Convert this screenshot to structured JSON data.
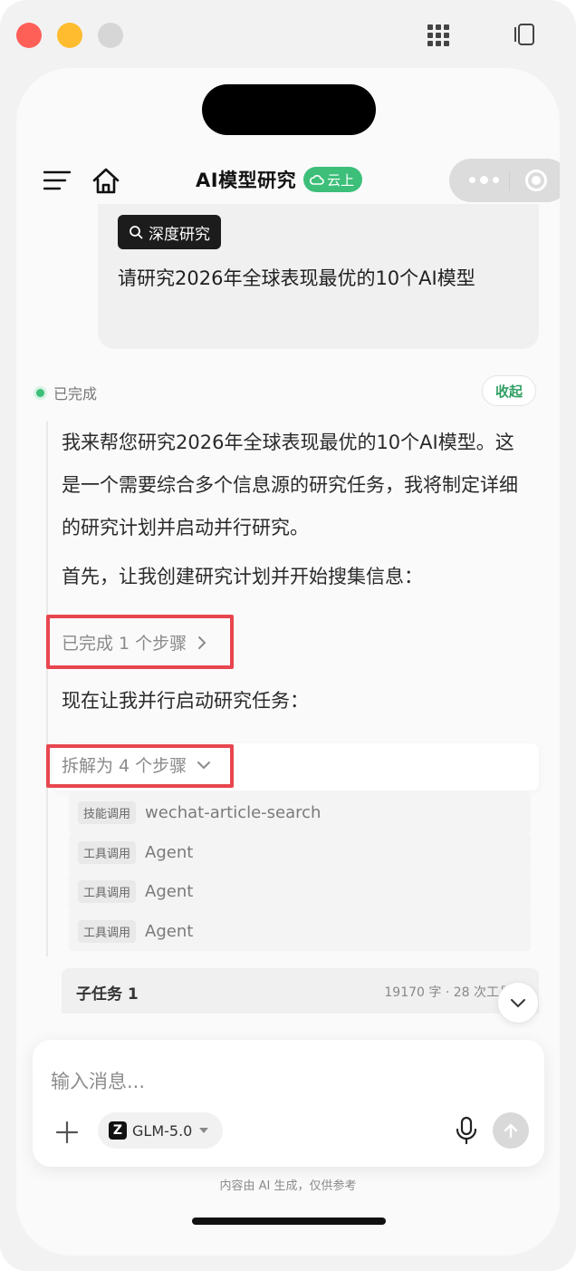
{
  "window": {
    "controls": [
      "close",
      "minimize",
      "zoom"
    ],
    "right_icons": [
      "grid-icon",
      "sidebar-toggle-icon"
    ]
  },
  "header": {
    "title": "AI模型研究",
    "badge": "云上",
    "badge_color": "#3dbf7a"
  },
  "user_message": {
    "tag": "深度研究",
    "text": "请研究2026年全球表现最优的10个AI模型"
  },
  "status": {
    "label": "已完成",
    "collapse_label": "收起"
  },
  "assistant": {
    "paragraph1": "我来帮您研究2026年全球表现最优的10个AI模型。这是一个需要综合多个信息源的研究任务，我将制定详细的研究计划并启动并行研究。",
    "paragraph2": "首先，让我创建研究计划并开始搜集信息：",
    "step1": "已完成 1 个步骤",
    "paragraph3": "现在让我并行启动研究任务：",
    "step2": "拆解为 4 个步骤",
    "tools": [
      {
        "tag": "技能调用",
        "name": "wechat-article-search"
      },
      {
        "tag": "工具调用",
        "name": "Agent"
      },
      {
        "tag": "工具调用",
        "name": "Agent"
      },
      {
        "tag": "工具调用",
        "name": "Agent"
      }
    ],
    "subtask": {
      "title": "子任务 1",
      "meta": "19170 字 · 28 次工具"
    }
  },
  "composer": {
    "placeholder": "输入消息...",
    "model": "GLM-5.0",
    "model_logo": "Z"
  },
  "footer": {
    "disclaimer": "内容由 AI 生成，仅供参考"
  },
  "colors": {
    "accent_green": "#3dbf7a",
    "highlight_red": "#e8464f"
  }
}
